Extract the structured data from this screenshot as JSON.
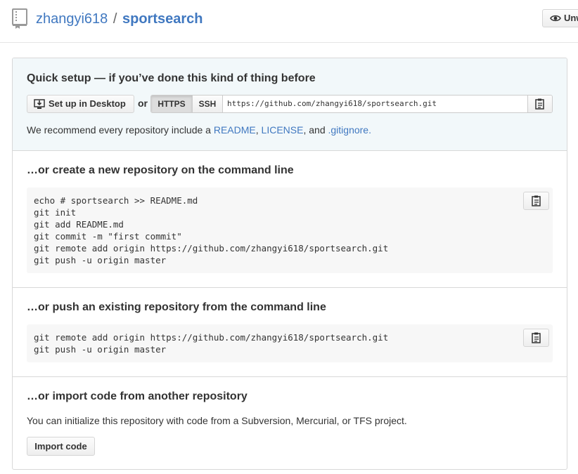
{
  "header": {
    "owner": "zhangyi618",
    "separator": "/",
    "repo_name": "sportsearch",
    "watch_label": "Unwatch"
  },
  "quick_setup": {
    "title": "Quick setup — if you’ve done this kind of thing before",
    "desktop_button": "Set up in Desktop",
    "or": "or",
    "https_label": "HTTPS",
    "ssh_label": "SSH",
    "clone_url": "https://github.com/zhangyi618/sportsearch.git",
    "recommend_prefix": "We recommend every repository include a ",
    "readme_link": "README",
    "comma1": ", ",
    "license_link": "LICENSE",
    "and_text": ", and ",
    "gitignore_link": ".gitignore",
    "period": "."
  },
  "create_new": {
    "title": "…or create a new repository on the command line",
    "code": "echo # sportsearch >> README.md\ngit init\ngit add README.md\ngit commit -m \"first commit\"\ngit remote add origin https://github.com/zhangyi618/sportsearch.git\ngit push -u origin master"
  },
  "push_existing": {
    "title": "…or push an existing repository from the command line",
    "code": "git remote add origin https://github.com/zhangyi618/sportsearch.git\ngit push -u origin master"
  },
  "import_code": {
    "title": "…or import code from another repository",
    "description": "You can initialize this repository with code from a Subversion, Mercurial, or TFS project.",
    "button": "Import code"
  },
  "colors": {
    "link": "#4078c0",
    "quick_setup_bg": "#f2f8fa",
    "code_bg": "#f7f7f7"
  },
  "icons": {
    "repo": "repo-icon",
    "watch": "eye-icon",
    "desktop": "desktop-download-icon",
    "copy": "clipboard-icon"
  }
}
